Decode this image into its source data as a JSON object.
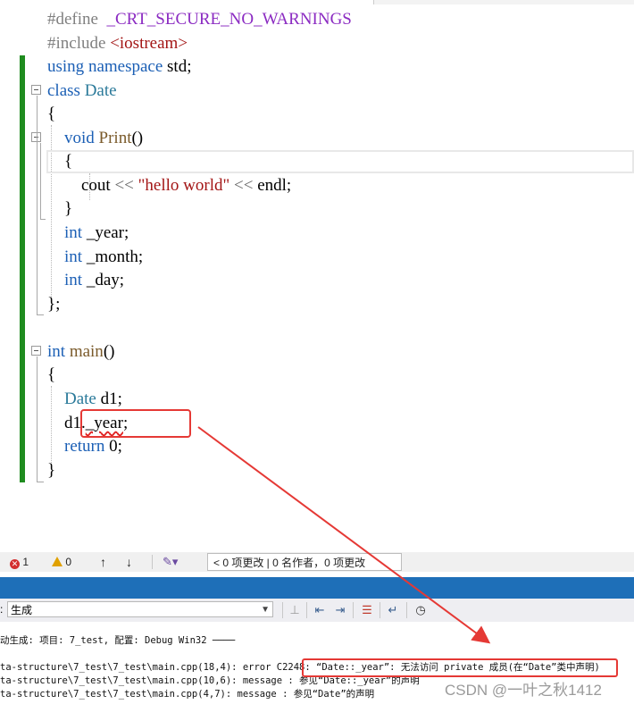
{
  "code_lines": [
    {
      "parts": [
        {
          "c": "pp",
          "t": "#define  "
        },
        {
          "c": "mac",
          "t": "_CRT_SECURE_NO_WARNINGS"
        }
      ]
    },
    {
      "parts": [
        {
          "c": "pp",
          "t": "#include "
        },
        {
          "c": "str",
          "t": "<iostream>"
        }
      ]
    },
    {
      "parts": [
        {
          "c": "kw",
          "t": "using"
        },
        {
          "c": "",
          "t": " "
        },
        {
          "c": "kw",
          "t": "namespace"
        },
        {
          "c": "",
          "t": " std;"
        }
      ]
    },
    {
      "parts": [
        {
          "c": "kw",
          "t": "class"
        },
        {
          "c": "",
          "t": " "
        },
        {
          "c": "ty",
          "t": "Date"
        }
      ]
    },
    {
      "parts": [
        {
          "c": "",
          "t": "{"
        }
      ]
    },
    {
      "parts": [
        {
          "c": "",
          "t": "    "
        },
        {
          "c": "kw",
          "t": "void"
        },
        {
          "c": "",
          "t": " "
        },
        {
          "c": "fn",
          "t": "Print"
        },
        {
          "c": "",
          "t": "()"
        }
      ]
    },
    {
      "parts": [
        {
          "c": "",
          "t": "    {"
        }
      ]
    },
    {
      "parts": [
        {
          "c": "",
          "t": "        cout "
        },
        {
          "c": "op",
          "t": "<<"
        },
        {
          "c": "",
          "t": " "
        },
        {
          "c": "str",
          "t": "\"hello world\""
        },
        {
          "c": "",
          "t": " "
        },
        {
          "c": "op",
          "t": "<<"
        },
        {
          "c": "",
          "t": " endl;"
        }
      ]
    },
    {
      "parts": [
        {
          "c": "",
          "t": "    }"
        }
      ]
    },
    {
      "parts": [
        {
          "c": "",
          "t": "    "
        },
        {
          "c": "kw",
          "t": "int"
        },
        {
          "c": "",
          "t": " _year;"
        }
      ]
    },
    {
      "parts": [
        {
          "c": "",
          "t": "    "
        },
        {
          "c": "kw",
          "t": "int"
        },
        {
          "c": "",
          "t": " _month;"
        }
      ]
    },
    {
      "parts": [
        {
          "c": "",
          "t": "    "
        },
        {
          "c": "kw",
          "t": "int"
        },
        {
          "c": "",
          "t": " _day;"
        }
      ]
    },
    {
      "parts": [
        {
          "c": "",
          "t": "};"
        }
      ]
    },
    {
      "parts": [
        {
          "c": "",
          "t": ""
        }
      ]
    },
    {
      "parts": [
        {
          "c": "kw",
          "t": "int"
        },
        {
          "c": "",
          "t": " "
        },
        {
          "c": "fn",
          "t": "main"
        },
        {
          "c": "",
          "t": "()"
        }
      ]
    },
    {
      "parts": [
        {
          "c": "",
          "t": "{"
        }
      ]
    },
    {
      "parts": [
        {
          "c": "",
          "t": "    "
        },
        {
          "c": "ty",
          "t": "Date"
        },
        {
          "c": "",
          "t": " d1;"
        }
      ]
    },
    {
      "parts": [
        {
          "c": "",
          "t": "    d1."
        },
        {
          "c": "squig",
          "t": "_year"
        },
        {
          "c": "",
          "t": ";"
        }
      ]
    },
    {
      "parts": [
        {
          "c": "",
          "t": "    "
        },
        {
          "c": "kw",
          "t": "return"
        },
        {
          "c": "",
          "t": " 0;"
        }
      ]
    },
    {
      "parts": [
        {
          "c": "",
          "t": "}"
        }
      ]
    }
  ],
  "status": {
    "errors": "1",
    "warnings": "0",
    "up_arrow": "↑",
    "down_arrow": "↓",
    "changes": "< 0 项更改 | 0 名作者，0 项更改"
  },
  "output": {
    "source": "生成",
    "lines": [
      "动生成: 项目: 7_test, 配置: Debug Win32 ────",
      "",
      "ta-structure\\7_test\\7_test\\main.cpp(18,4): error C2248: “Date::_year”: 无法访问 private 成员(在“Date”类中声明)",
      "ta-structure\\7_test\\7_test\\main.cpp(10,6): message : 参见“Date::_year”的声明",
      "ta-structure\\7_test\\7_test\\main.cpp(4,7): message : 参见“Date”的声明"
    ]
  },
  "watermark": "CSDN @一叶之秋1412",
  "colors": {
    "accent_red": "#e53935",
    "gutter_green": "#1f8c1f",
    "band_blue": "#1e6fb8"
  }
}
